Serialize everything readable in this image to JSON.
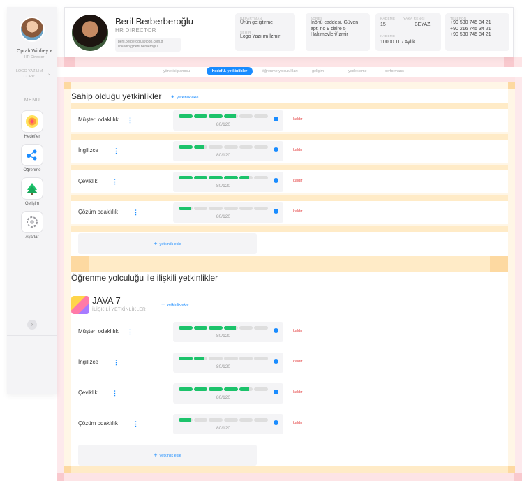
{
  "sidebar": {
    "user_name": "Oprah Winfrey",
    "user_role": "HR Director",
    "org": "LOGO YAZILIM CORP.",
    "menu_title": "MENU",
    "items": [
      {
        "label": "Hedefler"
      },
      {
        "label": "Öğrenme"
      },
      {
        "label": "Gelişim"
      },
      {
        "label": "Ayarlar"
      }
    ],
    "collapse": "«"
  },
  "header": {
    "name": "Beril Berberberoğlu",
    "title": "HR DIRECTOR",
    "email": "beril.berberoglu@logo.com.tr",
    "linkedin": "linkedin@beril.berberoglu",
    "department_label": "DEPARTMAN",
    "department": "Ürün geliştirme",
    "city_label": "ŞEHİR",
    "city": "Logo Yazılım İzmir",
    "address_label": "ADRES",
    "address": "İnönü caddesi. Güven apt. no 9 daire 5 Hakimevleri/İzmir",
    "level_label": "KADEME",
    "level": "15",
    "collar_label": "YAKA RENGİ",
    "collar": "BEYAZ",
    "salary_label": "KADEME",
    "salary": "10000 TL / Aylık",
    "phone_label": "TELEFON",
    "phones": [
      "+90 530 745 34 21",
      "+90 216 745 34 21",
      "+90 530 745 34 21"
    ]
  },
  "tabs": [
    {
      "label": "yönetici panosu"
    },
    {
      "label": "hedef & yetkinlikler"
    },
    {
      "label": "öğrenme yolculukları"
    },
    {
      "label": "gelişim"
    },
    {
      "label": "yedekleme"
    },
    {
      "label": "performans"
    }
  ],
  "owned": {
    "title": "Sahip olduğu yetkinlikler",
    "add_label": "yetkinlik ekle",
    "rows": [
      {
        "name": "Müşteri odaklılık",
        "score": "80/120",
        "progress": 0.64,
        "remove": "kaldır"
      },
      {
        "name": "İngilizce",
        "score": "80/120",
        "progress": 0.29,
        "remove": "kaldır"
      },
      {
        "name": "Çeviklik",
        "score": "80/120",
        "progress": 0.79,
        "remove": "kaldır"
      },
      {
        "name": "Çözüm odaklılık",
        "score": "80/120",
        "progress": 0.14,
        "remove": "kaldır"
      }
    ],
    "add_box": "yetkinlik ekle"
  },
  "journey": {
    "title": "Öğrenme yolculuğu ile ilişkili yetkinlikler",
    "course": "JAVA 7",
    "course_sub": "İLİŞKİLİ YETKİNLİKLER",
    "add_label": "yetkinlik ekle",
    "rows": [
      {
        "name": "Müşteri odaklılık",
        "score": "80/120",
        "progress": 0.64,
        "remove": "kaldır"
      },
      {
        "name": "İngilizce",
        "score": "80/120",
        "progress": 0.29,
        "remove": "kaldır"
      },
      {
        "name": "Çeviklik",
        "score": "80/120",
        "progress": 0.79,
        "remove": "kaldır"
      },
      {
        "name": "Çözüm odaklılık",
        "score": "80/120",
        "progress": 0.14,
        "remove": "kaldır"
      }
    ],
    "add_box": "yetkinlik ekle"
  },
  "colors": {
    "accent": "#1a8cff",
    "progress": "#1cc36b",
    "danger": "#e64a4a"
  },
  "icons": {
    "nav": [
      "target-icon",
      "flow-nodes-icon",
      "tree-icon",
      "gear-icon"
    ],
    "more": "kebab-icon",
    "info": "info-icon",
    "add": "plus-icon"
  }
}
